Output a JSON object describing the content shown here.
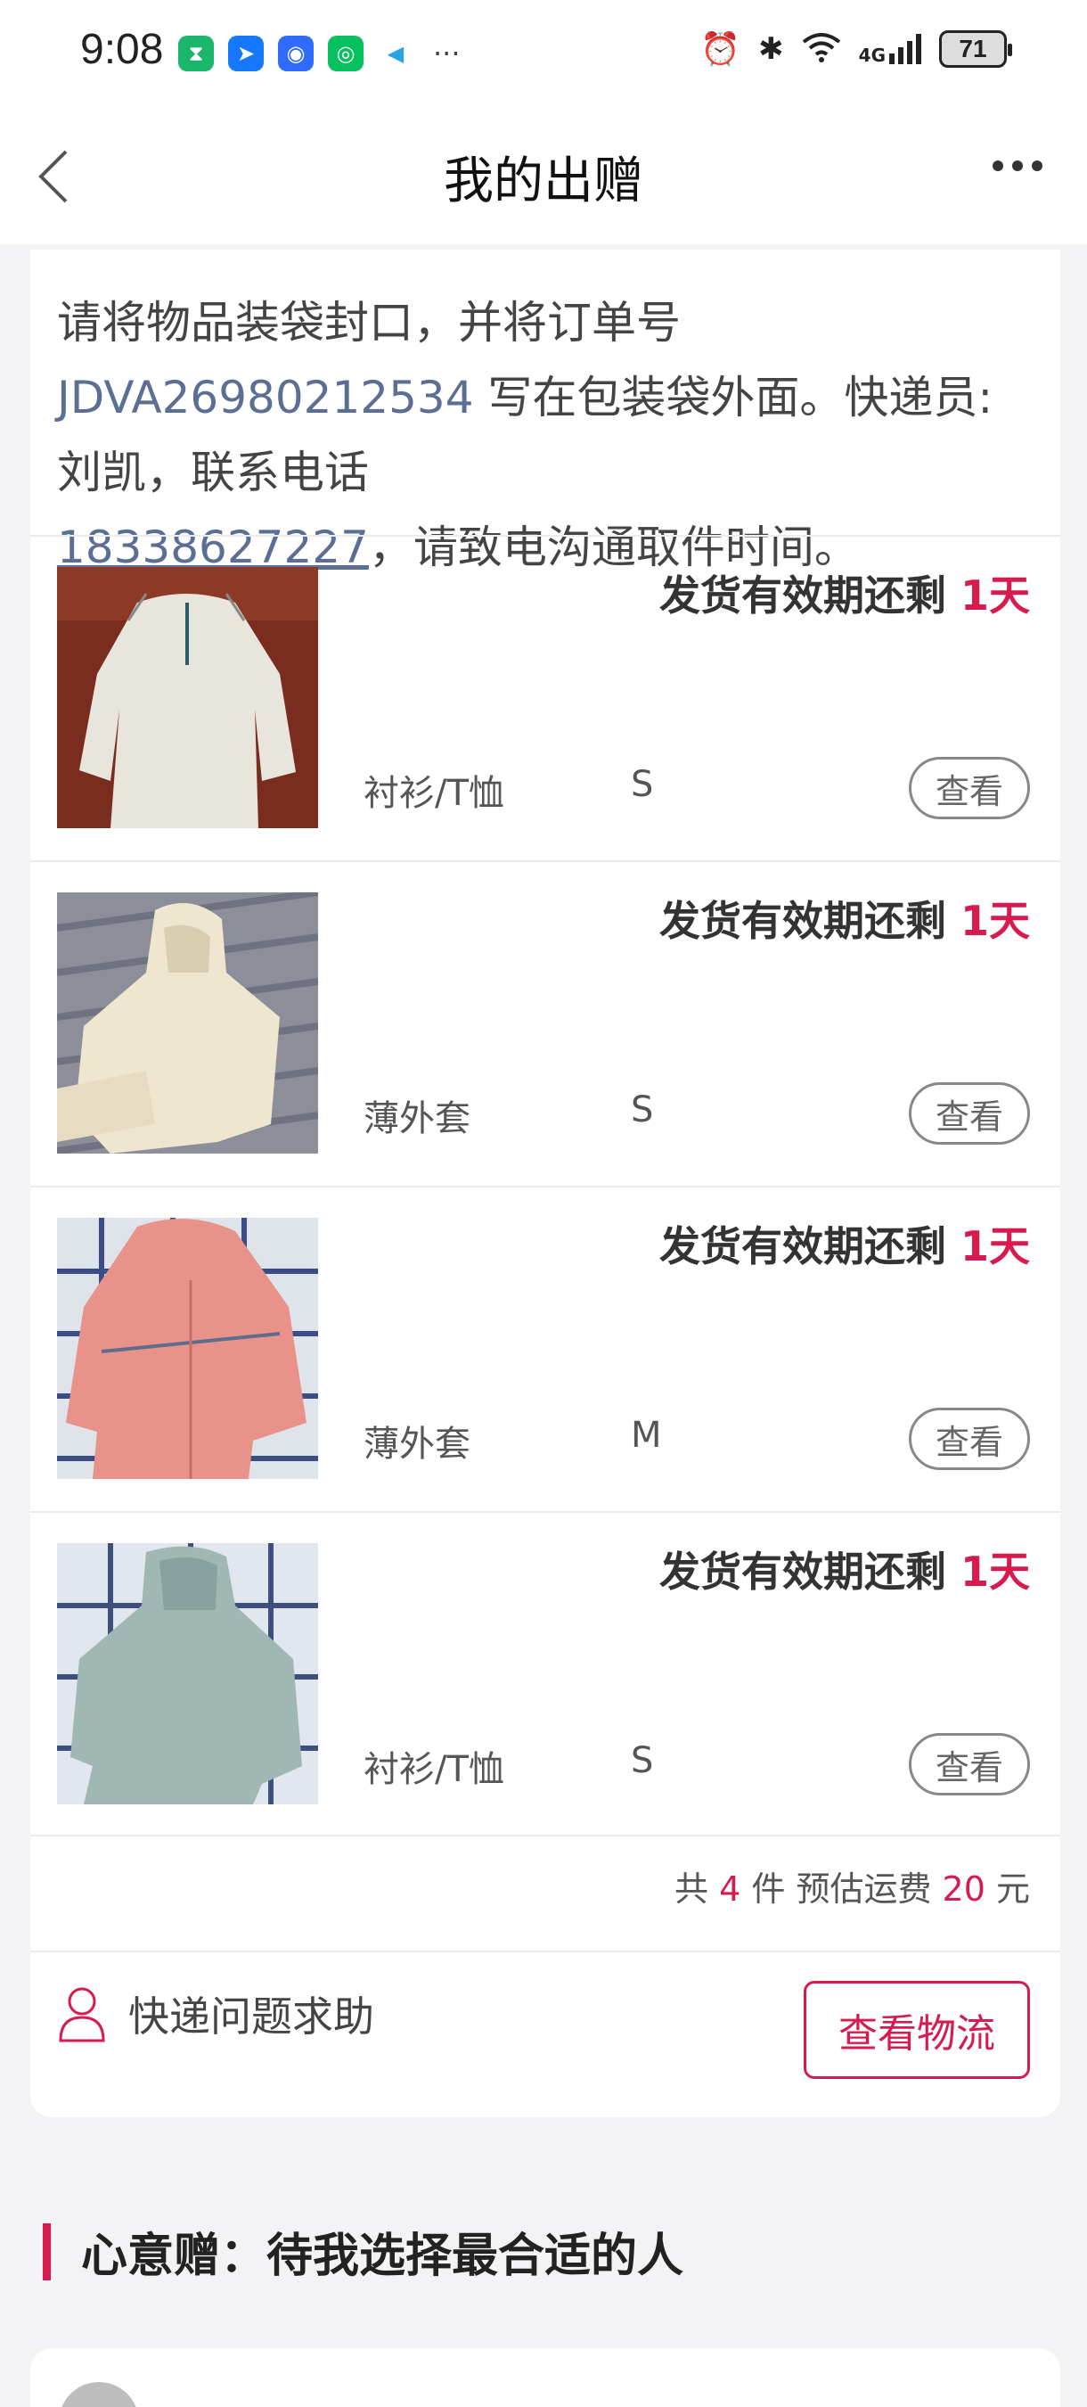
{
  "status_bar": {
    "time": "9:08",
    "app_icons": [
      {
        "icon": "hourglass-app-icon",
        "color": "#1bb56b",
        "glyph": "⧗"
      },
      {
        "icon": "navigation-app-icon",
        "color": "#1677ff",
        "glyph": "➤"
      },
      {
        "icon": "browser-app-icon",
        "color": "#2f6bff",
        "glyph": "◉"
      },
      {
        "icon": "wechat-app-icon",
        "color": "#07c160",
        "glyph": "◎"
      },
      {
        "icon": "telegram-app-icon",
        "color": "#2aa3e3",
        "glyph": "◀"
      }
    ],
    "more_glyph": "···",
    "network": "4G",
    "battery": "71"
  },
  "navbar": {
    "title": "我的出赠"
  },
  "notice": {
    "prefix": "请将物品装袋封口，并将订单号 ",
    "order_no": "JDVA26980212534",
    "middle": " 写在包装袋外面。快递员:刘凯，联系电话",
    "phone": "18338627227",
    "suffix": "，请致电沟通取件时间。"
  },
  "items": [
    {
      "expiry_label": "发货有效期还剩 ",
      "expiry_days": "1天",
      "category": "衬衫/T恤",
      "size": "S",
      "view_label": "查看",
      "image": "white-blouse"
    },
    {
      "expiry_label": "发货有效期还剩 ",
      "expiry_days": "1天",
      "category": "薄外套",
      "size": "S",
      "view_label": "查看",
      "image": "cream-hooded-jacket"
    },
    {
      "expiry_label": "发货有效期还剩 ",
      "expiry_days": "1天",
      "category": "薄外套",
      "size": "M",
      "view_label": "查看",
      "image": "pink-zip-jacket"
    },
    {
      "expiry_label": "发货有效期还剩 ",
      "expiry_days": "1天",
      "category": "衬衫/T恤",
      "size": "S",
      "view_label": "查看",
      "image": "mint-hoodie"
    }
  ],
  "summary": {
    "prefix": "共 ",
    "count": "4",
    "middle": " 件 预估运费 ",
    "fee": "20",
    "suffix": " 元"
  },
  "help": {
    "label": "快递问题求助",
    "logistics_button": "查看物流"
  },
  "section": {
    "title": "心意赠：待我选择最合适的人"
  },
  "colors": {
    "accent": "#d81b4f",
    "link": "#5b6e94",
    "background": "#f3f3f5"
  }
}
